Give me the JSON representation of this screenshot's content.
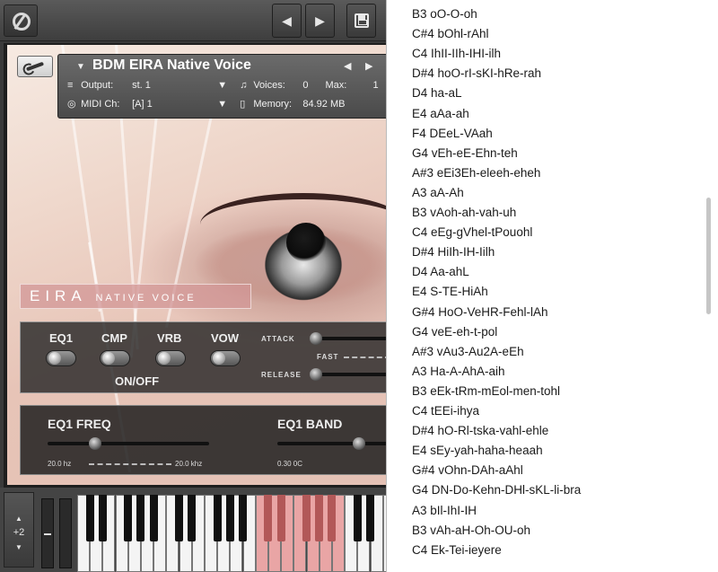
{
  "toolbar": {
    "prev_icon": "triangle-left",
    "next_icon": "triangle-right",
    "save_icon": "floppy-disk-icon"
  },
  "instrument": {
    "name": "BDM EIRA Native Voice",
    "output_label": "Output:",
    "output_value": "st. 1",
    "voices_label": "Voices:",
    "voices_value": "0",
    "max_label": "Max:",
    "max_value": "1",
    "midi_label": "MIDI Ch:",
    "midi_value": "[A]  1",
    "memory_label": "Memory:",
    "memory_value": "84.92 MB"
  },
  "banner": {
    "title": "EIRA",
    "subtitle": "NATIVE VOICE"
  },
  "switches": {
    "eq1": "EQ1",
    "cmp": "CMP",
    "vrb": "VRB",
    "vow": "VOW",
    "onoff": "ON/OFF"
  },
  "envelope": {
    "attack": "ATTACK",
    "fast": "FAST",
    "release": "RELEASE"
  },
  "eq": {
    "freq_title": "EQ1 FREQ",
    "freq_min": "20.0 hz",
    "freq_max": "20.0 khz",
    "band_title": "EQ1 BAND",
    "band_min": "0.30 0C"
  },
  "keyboard": {
    "octave": "+2"
  },
  "menu": {
    "items": [
      "B3 oO-O-oh",
      "C#4 bOhl-rAhl",
      "C4 IhII-IIh-IHI-ilh",
      "D#4 hoO-rI-sKI-hRe-rah",
      "D4 ha-aL",
      "E4 aAa-ah",
      "F4 DEeL-VAah",
      "G4 vEh-eE-Ehn-teh",
      "A#3 eEi3Eh-eleeh-eheh",
      "A3 aA-Ah",
      "B3 vAoh-ah-vah-uh",
      "C4 eEg-gVhel-tPouohl",
      "D#4 HiIh-IH-Iilh",
      "D4 Aa-ahL",
      "E4 S-TE-HiAh",
      "G#4 HoO-VeHR-Fehl-lAh",
      "G4 veE-eh-t-pol",
      "A#3 vAu3-Au2A-eEh",
      "A3 Ha-A-AhA-aih",
      "B3 eEk-tRm-mEol-men-tohl",
      "C4 tEEi-ihya",
      "D#4 hO-Rl-tska-vahl-ehle",
      "E4 sEy-yah-haha-heaah",
      "G#4 vOhn-DAh-aAhl",
      "G4 DN-Do-Kehn-DHl-sKL-li-bra",
      "A3 bIl-IhI-IH",
      "B3 vAh-aH-Oh-OU-oh",
      "C4 Ek-Tei-ieyere"
    ]
  }
}
